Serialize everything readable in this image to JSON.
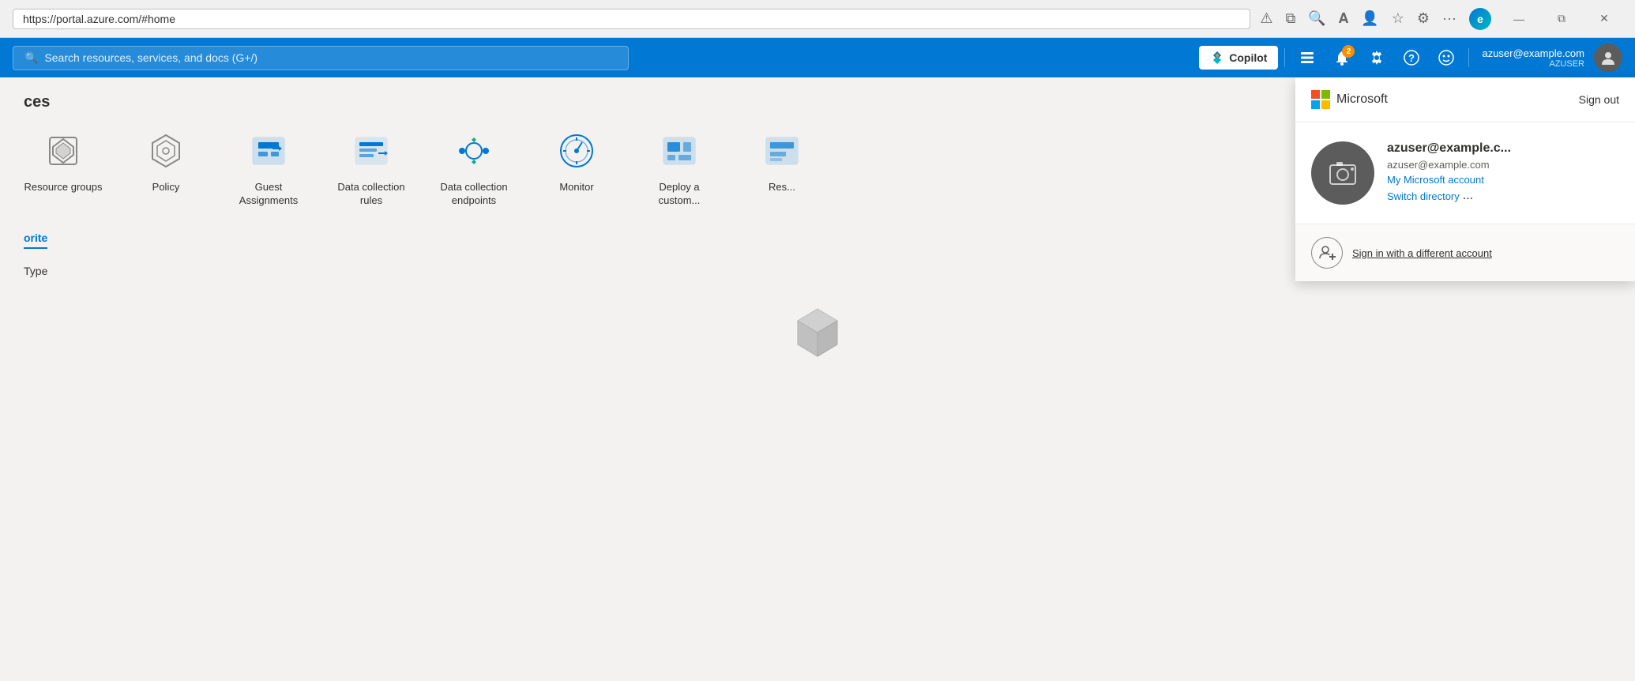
{
  "browser": {
    "address": "https://portal.azure.com/#home",
    "controls": {
      "minimize": "—",
      "maximize": "⧉",
      "close": "✕"
    }
  },
  "header": {
    "search_placeholder": "Search resources, services, and docs (G+/)",
    "copilot_label": "Copilot",
    "notification_count": "2",
    "user_email": "azuser@example.com",
    "user_name": "AZUSER"
  },
  "services": {
    "section_title": "ces",
    "items": [
      {
        "label": "Resource groups",
        "icon": "resource-groups-icon"
      },
      {
        "label": "Policy",
        "icon": "policy-icon"
      },
      {
        "label": "Guest Assignments",
        "icon": "guest-assignments-icon"
      },
      {
        "label": "Data collection rules",
        "icon": "data-collection-rules-icon"
      },
      {
        "label": "Data collection endpoints",
        "icon": "data-collection-endpoints-icon"
      },
      {
        "label": "Monitor",
        "icon": "monitor-icon"
      },
      {
        "label": "Deploy a custom...",
        "icon": "deploy-custom-icon"
      },
      {
        "label": "Res...",
        "icon": "resource-icon"
      }
    ]
  },
  "favorite": {
    "tab_label": "orite",
    "type_label": "Type"
  },
  "account_panel": {
    "ms_brand": "Microsoft",
    "sign_out_label": "Sign out",
    "display_name": "azuser@example.c...",
    "email": "azuser@example.com",
    "my_account_label": "My Microsoft account",
    "switch_directory_label": "Switch directory",
    "ellipsis_label": "...",
    "sign_in_different_label": "Sign in with a different account"
  }
}
